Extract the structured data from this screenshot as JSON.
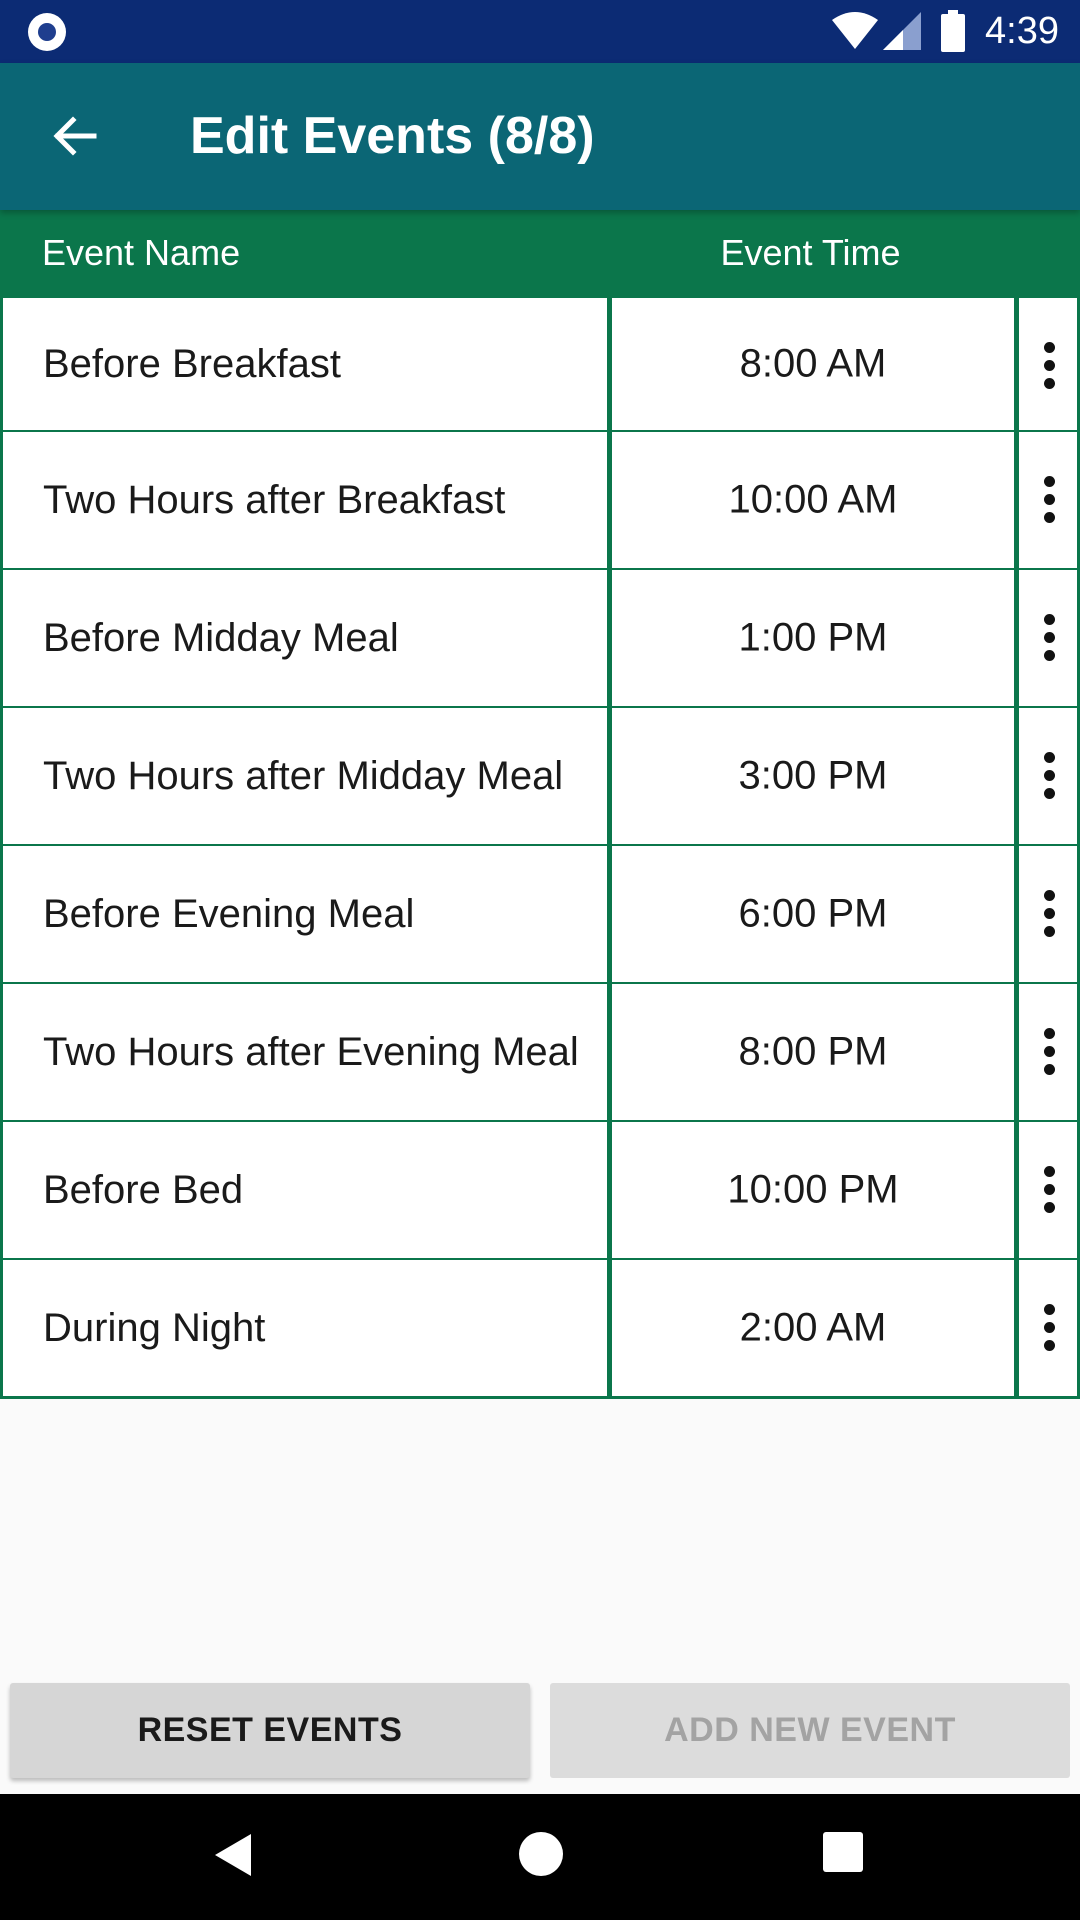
{
  "status_bar": {
    "time": "4:39",
    "icons": [
      "notification-dot-icon",
      "wifi-icon",
      "signal-icon",
      "battery-icon"
    ]
  },
  "app_bar": {
    "title": "Edit Events (8/8)",
    "back_icon": "arrow-left-icon"
  },
  "table": {
    "headers": {
      "name": "Event Name",
      "time": "Event Time"
    },
    "rows": [
      {
        "name": "Before Breakfast",
        "time": "8:00 AM"
      },
      {
        "name": "Two Hours after Breakfast",
        "time": "10:00 AM"
      },
      {
        "name": "Before Midday Meal",
        "time": "1:00 PM"
      },
      {
        "name": "Two Hours after Midday Meal",
        "time": "3:00 PM"
      },
      {
        "name": "Before Evening Meal",
        "time": "6:00 PM"
      },
      {
        "name": "Two Hours after Evening Meal",
        "time": "8:00 PM"
      },
      {
        "name": "Before Bed",
        "time": "10:00 PM"
      },
      {
        "name": "During Night",
        "time": "2:00 AM"
      }
    ],
    "row_menu_icon": "more-vert-icon"
  },
  "buttons": {
    "reset": "RESET EVENTS",
    "add": "ADD NEW EVENT"
  },
  "nav_bar": {
    "icons": [
      "nav-back-icon",
      "nav-home-icon",
      "nav-recents-icon"
    ]
  },
  "colors": {
    "status_bar": "#0c2b74",
    "app_bar": "#0b6675",
    "table_accent": "#0b764b",
    "background": "#fafafa"
  }
}
